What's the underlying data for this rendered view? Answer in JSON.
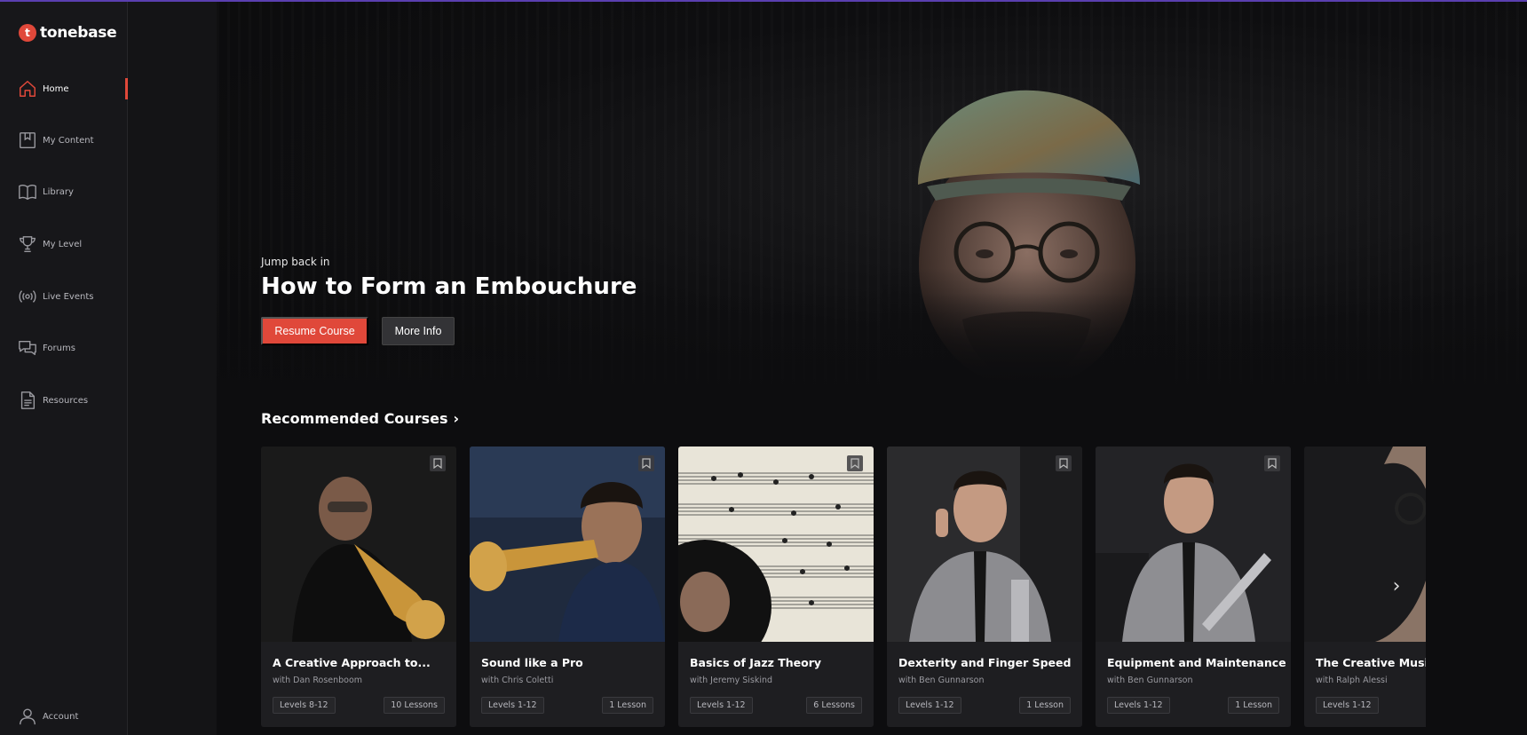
{
  "brand": {
    "name": "tonebase",
    "accent": "#e0483a"
  },
  "sidebar": {
    "items": [
      {
        "label": "Home",
        "icon": "home-icon",
        "active": true
      },
      {
        "label": "My Content",
        "icon": "bookmark-book-icon"
      },
      {
        "label": "Library",
        "icon": "book-open-icon"
      },
      {
        "label": "My Level",
        "icon": "trophy-icon"
      },
      {
        "label": "Live Events",
        "icon": "broadcast-icon"
      },
      {
        "label": "Forums",
        "icon": "chat-bubbles-icon"
      },
      {
        "label": "Resources",
        "icon": "document-icon"
      }
    ],
    "account_label": "Account"
  },
  "hero": {
    "eyebrow": "Jump back in",
    "title": "How to Form an Embouchure",
    "primary_button": "Resume Course",
    "secondary_button": "More Info"
  },
  "recommended": {
    "title": "Recommended Courses",
    "cards": [
      {
        "title": "A Creative Approach to...",
        "instructor": "with Dan Rosenboom",
        "levels": "Levels 8-12",
        "lessons": "10 Lessons"
      },
      {
        "title": "Sound like a Pro",
        "instructor": "with Chris Coletti",
        "levels": "Levels 1-12",
        "lessons": "1 Lesson"
      },
      {
        "title": "Basics of Jazz Theory",
        "instructor": "with Jeremy Siskind",
        "levels": "Levels 1-12",
        "lessons": "6 Lessons"
      },
      {
        "title": "Dexterity and Finger Speed",
        "instructor": "with Ben Gunnarson",
        "levels": "Levels 1-12",
        "lessons": "1 Lesson"
      },
      {
        "title": "Equipment and Maintenance",
        "instructor": "with Ben Gunnarson",
        "levels": "Levels 1-12",
        "lessons": "1 Lesson"
      },
      {
        "title": "The Creative Musicia",
        "instructor": "with Ralph Alessi",
        "levels": "Levels 1-12",
        "lessons": ""
      }
    ]
  }
}
